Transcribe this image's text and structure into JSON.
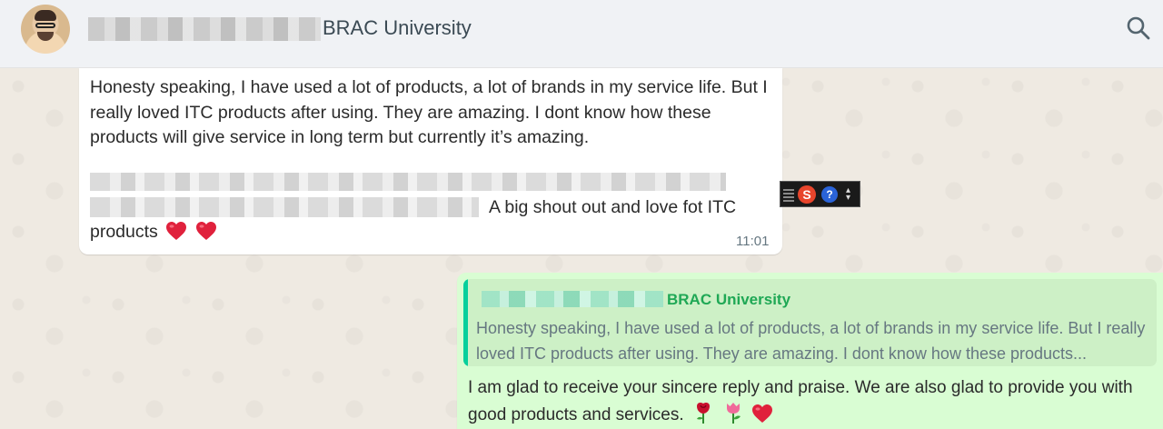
{
  "header": {
    "contact_name": "BRAC University",
    "icons": {
      "search": "search-icon"
    }
  },
  "messages": {
    "incoming": {
      "paragraph1": "Honesty speaking, I have used a lot of products, a lot of brands in my service life. But I really loved ITC products after using. They are amazing. I dont know how these products will give service in long term but currently it’s amazing.",
      "line_tail": "A big shout out and love fot ITC",
      "line_last": "products",
      "emojis": [
        "heart",
        "heart"
      ],
      "time": "11:01"
    },
    "outgoing": {
      "quoted_author": "BRAC University",
      "quoted_text": "Honesty speaking, I have used a lot of products, a lot of brands in my service life. But I really loved ITC products after using. They are amazing. I dont know how these products...",
      "text": "I am glad to receive your sincere reply and praise. We are also glad to provide you with good products and services.",
      "emojis": [
        "rose",
        "tulip",
        "heart"
      ]
    }
  },
  "ime_toolbar": {
    "icons": [
      "sogou-s-icon",
      "help-icon",
      "dropdown-icon"
    ],
    "s_label": "S",
    "q_label": "?"
  },
  "colors": {
    "header_bg": "#f0f2f5",
    "chat_bg": "#efeae2",
    "incoming_bg": "#ffffff",
    "outgoing_bg": "#d9fdd3",
    "quote_accent": "#06cf9c",
    "quote_author": "#1fa855"
  }
}
